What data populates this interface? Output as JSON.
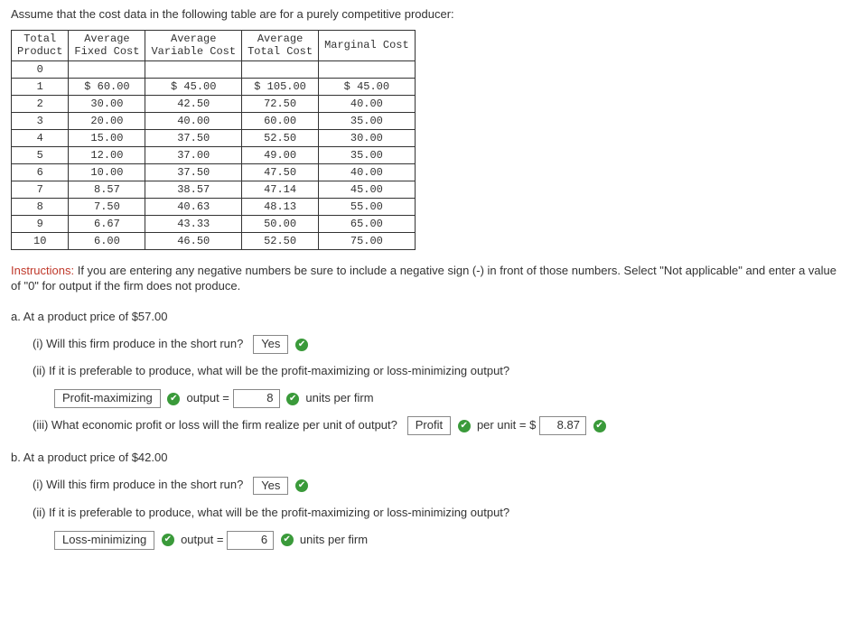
{
  "intro": "Assume that the cost data in the following table are for a purely competitive producer:",
  "table": {
    "headers": {
      "col0_line1": "Total",
      "col0_line2": "Product",
      "col1_line1": "Average",
      "col1_line2": "Fixed Cost",
      "col2_line1": "Average",
      "col2_line2": "Variable Cost",
      "col3_line1": "Average",
      "col3_line2": "Total Cost",
      "col4_line1": "Marginal Cost",
      "col4_line2": ""
    },
    "rows": [
      {
        "tp": "0",
        "afc": "",
        "avc": "",
        "atc": "",
        "mc": ""
      },
      {
        "tp": "1",
        "afc": "$ 60.00",
        "avc": "$ 45.00",
        "atc": "$ 105.00",
        "mc": "$ 45.00"
      },
      {
        "tp": "2",
        "afc": "30.00",
        "avc": "42.50",
        "atc": "72.50",
        "mc": "40.00"
      },
      {
        "tp": "3",
        "afc": "20.00",
        "avc": "40.00",
        "atc": "60.00",
        "mc": "35.00"
      },
      {
        "tp": "4",
        "afc": "15.00",
        "avc": "37.50",
        "atc": "52.50",
        "mc": "30.00"
      },
      {
        "tp": "5",
        "afc": "12.00",
        "avc": "37.00",
        "atc": "49.00",
        "mc": "35.00"
      },
      {
        "tp": "6",
        "afc": "10.00",
        "avc": "37.50",
        "atc": "47.50",
        "mc": "40.00"
      },
      {
        "tp": "7",
        "afc": "8.57",
        "avc": "38.57",
        "atc": "47.14",
        "mc": "45.00"
      },
      {
        "tp": "8",
        "afc": "7.50",
        "avc": "40.63",
        "atc": "48.13",
        "mc": "55.00"
      },
      {
        "tp": "9",
        "afc": "6.67",
        "avc": "43.33",
        "atc": "50.00",
        "mc": "65.00"
      },
      {
        "tp": "10",
        "afc": "6.00",
        "avc": "46.50",
        "atc": "52.50",
        "mc": "75.00"
      }
    ]
  },
  "instructions": {
    "label": "Instructions:",
    "text": " If you are entering any negative numbers be sure to include a negative sign (-) in front of those numbers. Select \"Not applicable\" and enter a value of \"0\" for output if the firm does not produce."
  },
  "a": {
    "header": "a. At a product price of $57.00",
    "i": {
      "q": "(i) Will this firm produce in the short run?",
      "ans": "Yes"
    },
    "ii": {
      "q": "(ii) If it is preferable to produce, what will be the profit-maximizing or loss-minimizing output?",
      "select": "Profit-maximizing",
      "out_label_pre": "output =",
      "out_val": "8",
      "out_label_post": "units per firm"
    },
    "iii": {
      "q": "(iii) What economic profit or loss will the firm realize per unit of output?",
      "select": "Profit",
      "per_unit_pre": "per unit = $",
      "per_unit_val": "8.87"
    }
  },
  "b": {
    "header": "b. At a product price of $42.00",
    "i": {
      "q": "(i) Will this firm produce in the short run?",
      "ans": "Yes"
    },
    "ii": {
      "q": "(ii) If it is preferable to produce, what will be the profit-maximizing or loss-minimizing output?",
      "select": "Loss-minimizing",
      "out_label_pre": "output =",
      "out_val": "6",
      "out_label_post": "units per firm"
    }
  }
}
